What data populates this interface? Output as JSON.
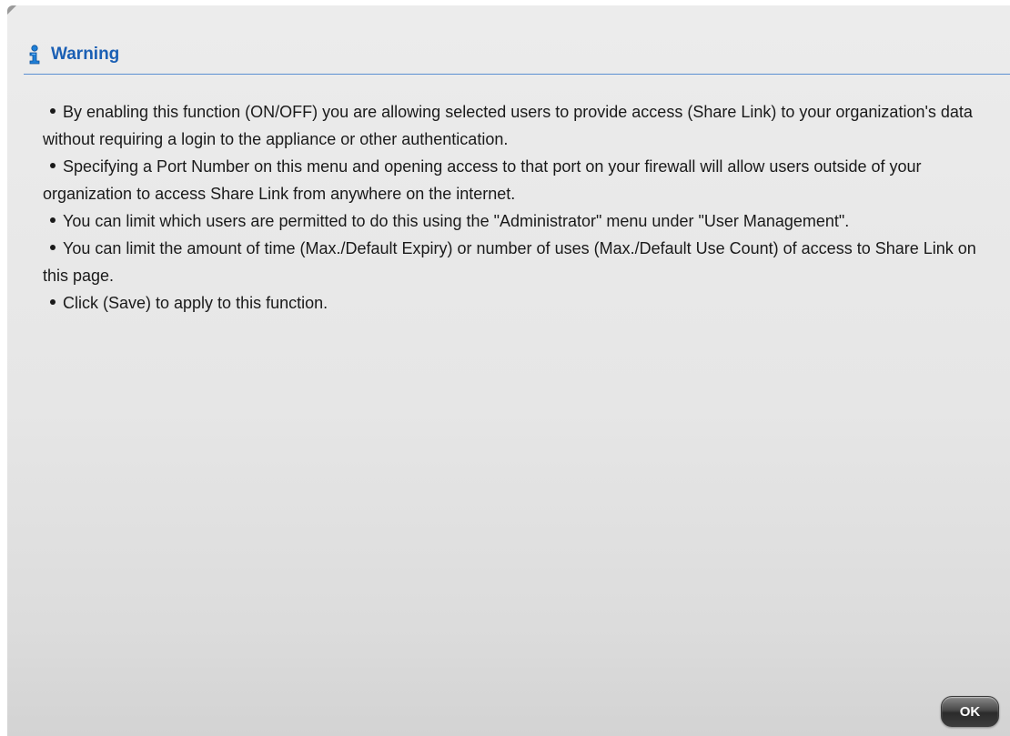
{
  "dialog": {
    "title": "Warning",
    "title_icon": "info-icon",
    "accent_color": "#1a5fb4",
    "bullets": [
      {
        "text": "By enabling this function  (ON/OFF)  you are allowing selected users to provide access (Share Link) to your organization's data without requiring a login to the appliance or other authentication."
      },
      {
        "text": "Specifying a  Port Number  on this menu and opening access to that port on your firewall will allow users outside of your organization to access Share Link from anywhere on the internet."
      },
      {
        "text": "You can limit which users are permitted to do this using the \"Administrator\"  menu under \"User Management\"."
      },
      {
        "text": "You can limit the amount of time (Max./Default Expiry) or number of uses (Max./Default Use Count) of access to Share Link on this page."
      },
      {
        "text": "Click (Save) to apply to this function."
      }
    ],
    "ok_label": "OK"
  }
}
